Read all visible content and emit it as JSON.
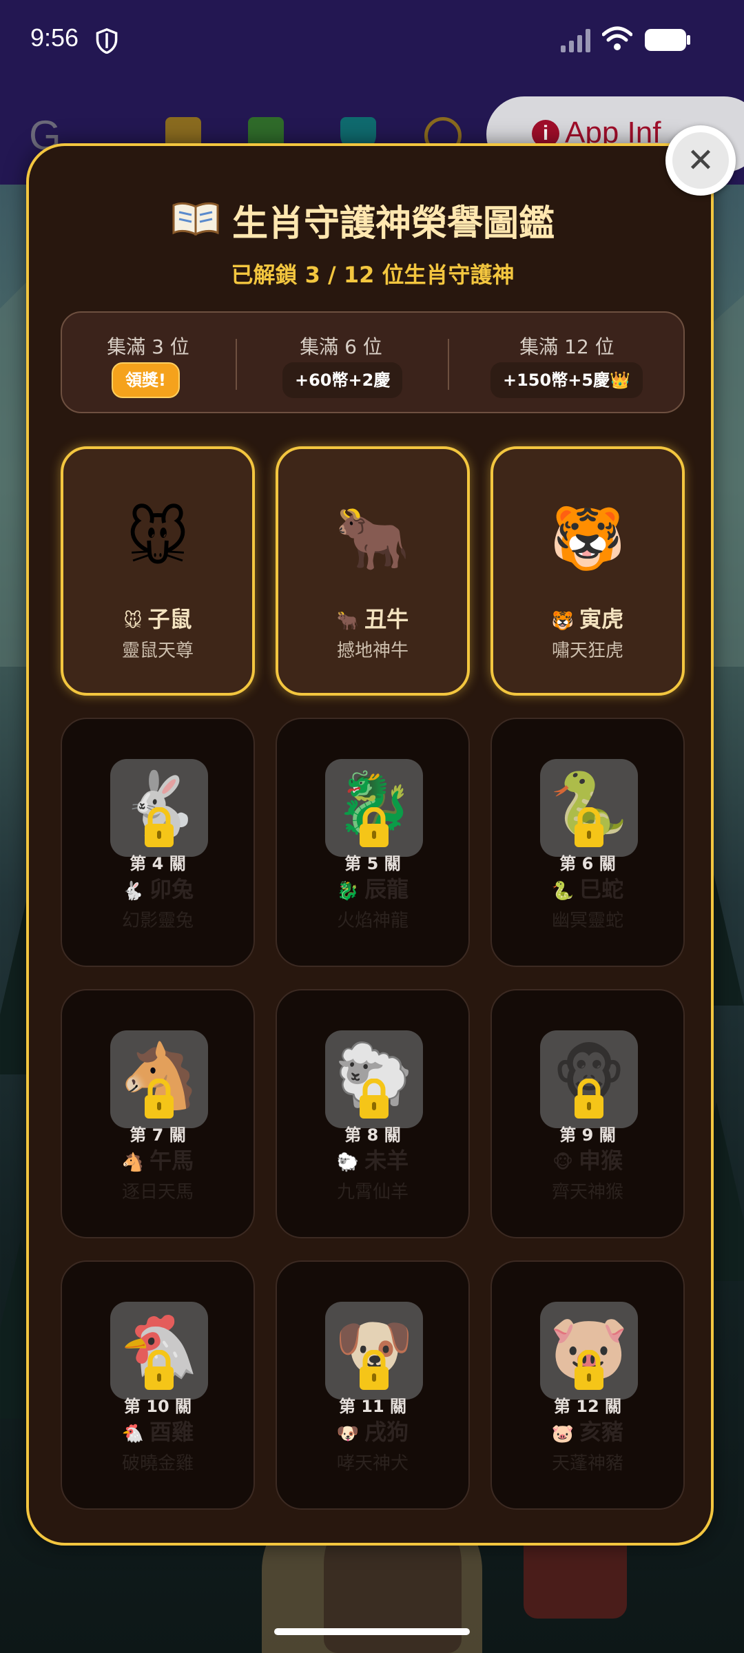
{
  "status_bar": {
    "time": "9:56"
  },
  "toolbar": {
    "logo_letter": "G",
    "app_info_label": "App Inf",
    "app_info_icon": "i"
  },
  "modal": {
    "close_icon": "✕",
    "title": "生肖守護神榮譽圖鑑",
    "subtitle": "已解鎖 3 / 12 位生肖守護神",
    "milestones": [
      {
        "label": "集滿 3 位",
        "reward": "領獎!"
      },
      {
        "label": "集滿 6 位",
        "reward": "+60幣+2慶"
      },
      {
        "label": "集滿 12 位",
        "reward": "+150幣+5慶👑"
      }
    ],
    "cards": [
      {
        "emoji": "🐭",
        "name": "子鼠",
        "title": "靈鼠天尊",
        "locked": false
      },
      {
        "emoji": "🐂",
        "name": "丑牛",
        "title": "撼地神牛",
        "locked": false
      },
      {
        "emoji": "🐯",
        "name": "寅虎",
        "title": "嘯天狂虎",
        "locked": false
      },
      {
        "emoji": "🐇",
        "name": "卯兔",
        "title": "幻影靈兔",
        "locked": true,
        "stage": "第 4 關"
      },
      {
        "emoji": "🐉",
        "name": "辰龍",
        "title": "火焰神龍",
        "locked": true,
        "stage": "第 5 關"
      },
      {
        "emoji": "🐍",
        "name": "巳蛇",
        "title": "幽冥靈蛇",
        "locked": true,
        "stage": "第 6 關"
      },
      {
        "emoji": "🐴",
        "name": "午馬",
        "title": "逐日天馬",
        "locked": true,
        "stage": "第 7 關"
      },
      {
        "emoji": "🐑",
        "name": "未羊",
        "title": "九霄仙羊",
        "locked": true,
        "stage": "第 8 關"
      },
      {
        "emoji": "🐵",
        "name": "申猴",
        "title": "齊天神猴",
        "locked": true,
        "stage": "第 9 關"
      },
      {
        "emoji": "🐔",
        "name": "酉雞",
        "title": "破曉金雞",
        "locked": true,
        "stage": "第 10 關"
      },
      {
        "emoji": "🐶",
        "name": "戌狗",
        "title": "哮天神犬",
        "locked": true,
        "stage": "第 11 關"
      },
      {
        "emoji": "🐷",
        "name": "亥豬",
        "title": "天蓬神豬",
        "locked": true,
        "stage": "第 12 關"
      }
    ]
  },
  "colors": {
    "gold": "#f3c63f",
    "modal_bg": "#28170e",
    "claim": "#f5a21c"
  }
}
